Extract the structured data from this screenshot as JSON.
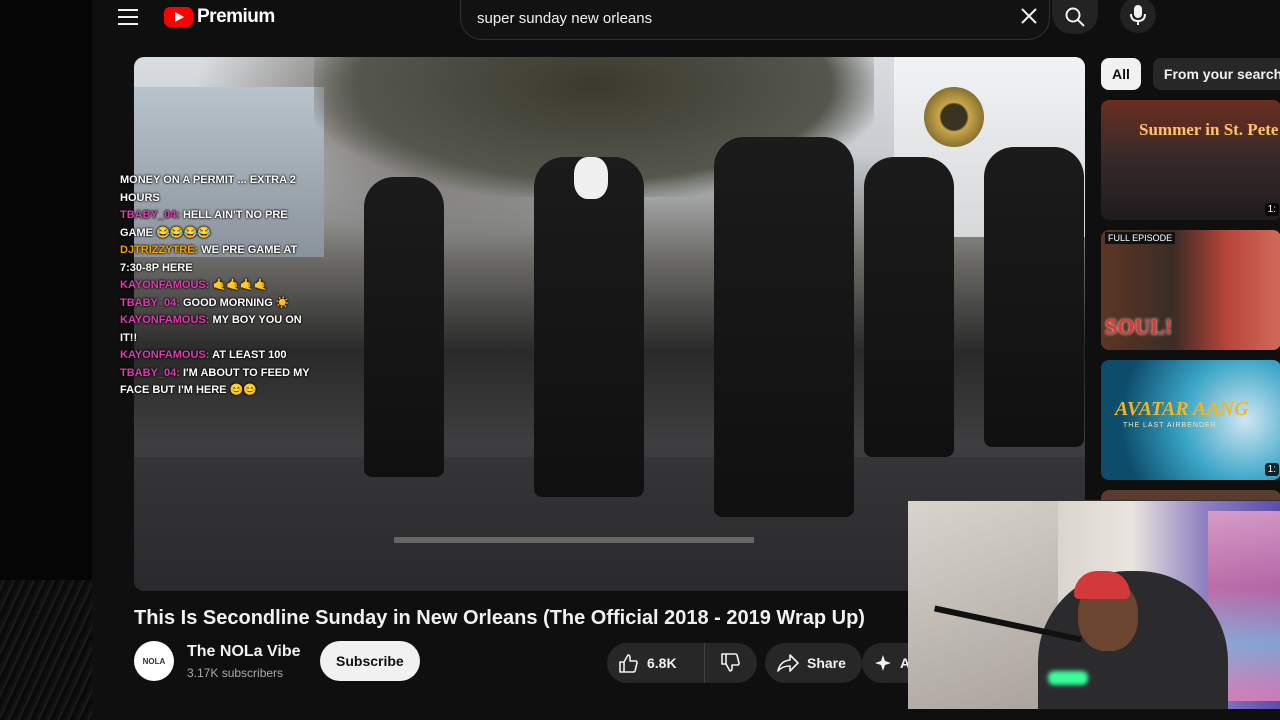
{
  "header": {
    "brand": "Premium",
    "search_query": "super sunday new orleans"
  },
  "chat": [
    {
      "user": "",
      "text": "MONEY ON A PERMIT ... EXTRA 2 HOURS"
    },
    {
      "user": "TBABY_04:",
      "text": "HELL AIN'T NO PRE GAME 😂😂😂😂"
    },
    {
      "user": "DJTRIZZYTRE:",
      "text": "WE PRE GAME AT 7:30-8P HERE"
    },
    {
      "user": "KAYONFAMOUS:",
      "text": "🤙🤙🤙🤙"
    },
    {
      "user": "TBABY_04:",
      "text": "GOOD MORNING ☀️"
    },
    {
      "user": "KAYONFAMOUS:",
      "text": "MY BOY YOU ON IT!!"
    },
    {
      "user": "KAYONFAMOUS:",
      "text": "AT LEAST 100"
    },
    {
      "user": "TBABY_04:",
      "text": "I'M ABOUT TO FEED MY FACE BUT I'M HERE 😊😊"
    }
  ],
  "chips": [
    "All",
    "From your search"
  ],
  "recommendations": [
    {
      "title": "Summer in St. Pete",
      "duration": "1:"
    },
    {
      "badge": "FULL EPISODE",
      "title": "SOUL!"
    },
    {
      "title": "AVATAR AANG",
      "subtitle": "THE LAST AIRBENDER",
      "duration": "1:"
    }
  ],
  "video": {
    "title": "This Is Secondline Sunday in New Orleans (The Official 2018 - 2019 Wrap Up)",
    "channel": "The NOLa Vibe",
    "subscribers": "3.17K subscribers",
    "avatar_text": "NOLA",
    "subscribe_label": "Subscribe",
    "likes": "6.8K",
    "share_label": "Share",
    "ask_label": "A"
  }
}
